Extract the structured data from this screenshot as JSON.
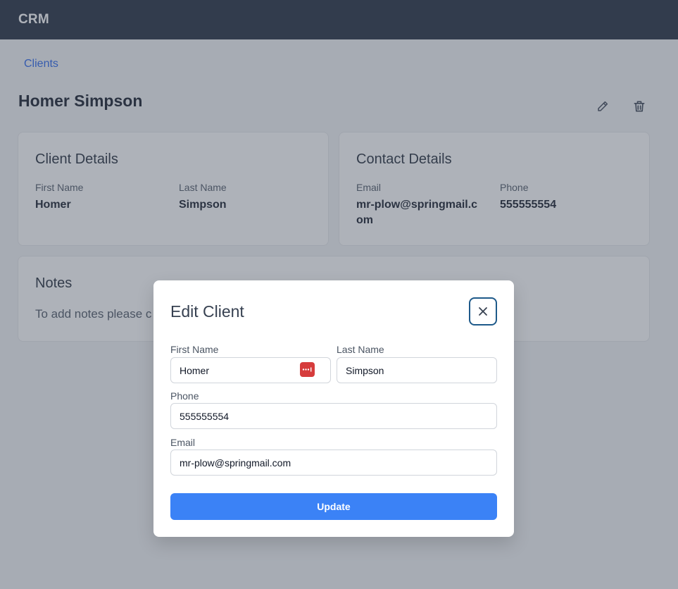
{
  "app": {
    "brand": "CRM"
  },
  "breadcrumb": {
    "link": "Clients"
  },
  "client": {
    "full_name": "Homer Simpson",
    "details_heading": "Client Details",
    "first_name_label": "First Name",
    "first_name": "Homer",
    "last_name_label": "Last Name",
    "last_name": "Simpson"
  },
  "contact": {
    "heading": "Contact Details",
    "email_label": "Email",
    "email": "mr-plow@springmail.com",
    "phone_label": "Phone",
    "phone": "555555554"
  },
  "notes": {
    "heading": "Notes",
    "text": "To add notes please c"
  },
  "actions": {
    "edit_icon": "pencil-icon",
    "delete_icon": "trash-icon"
  },
  "modal": {
    "title": "Edit Client",
    "close_icon": "close-icon",
    "first_name_label": "First Name",
    "first_name_value": "Homer",
    "last_name_label": "Last Name",
    "last_name_value": "Simpson",
    "phone_label": "Phone",
    "phone_value": "555555554",
    "email_label": "Email",
    "email_value": "mr-plow@springmail.com",
    "submit_label": "Update",
    "password_manager_icon": "password-manager-icon"
  },
  "colors": {
    "navbar": "#1e293b",
    "link": "#2563eb",
    "primary_button": "#3b82f6",
    "password_manager": "#d63c3c"
  }
}
